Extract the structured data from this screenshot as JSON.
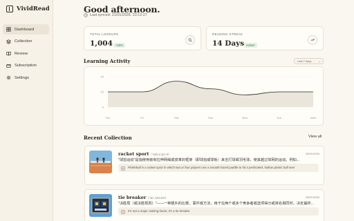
{
  "app": {
    "name": "VividRead"
  },
  "sidebar": {
    "items": [
      {
        "label": "Dashboard",
        "icon": "grid-icon",
        "active": true
      },
      {
        "label": "Collection",
        "icon": "layers-icon"
      },
      {
        "label": "Review",
        "icon": "book-icon"
      },
      {
        "label": "Subscription",
        "icon": "card-icon"
      },
      {
        "label": "Settings",
        "icon": "gear-icon"
      }
    ]
  },
  "header": {
    "greeting": "Good afternoon.",
    "last_synced": "Last synced: 21/01/2026, 23:12:27"
  },
  "stats": {
    "lookups": {
      "label": "TOTAL LOOKUPS",
      "value": "1,004",
      "change": "+18%",
      "icon": "search-icon"
    },
    "streak": {
      "label": "READING STREAK",
      "value": "14 Days",
      "status": "Active!",
      "icon": "trend-up-icon"
    }
  },
  "activity": {
    "title": "Learning Activity",
    "range": "Last 7 days"
  },
  "chart_data": {
    "type": "area",
    "categories": [
      "Thu",
      "Fri",
      "Sat",
      "Sun",
      "Mon",
      "Tue",
      "Wed"
    ],
    "values": [
      10,
      10,
      17,
      12,
      8,
      10,
      10
    ],
    "ylim": [
      0,
      20
    ],
    "yticks": [
      0,
      10,
      20
    ],
    "grid": true
  },
  "collection": {
    "title": "Recent Collection",
    "view_all": "View all",
    "entries": [
      {
        "word": "racket sport",
        "pos": "/ˈræk.ɪt spɔːrt/",
        "date": "30/01/2026",
        "definition": "\"球拍运动\"是指使用装有拉伸网绳或皮革的框架（即球拍或球板）来击打球或羽毛球，使其越过球网的运动。例如...",
        "example": "Pickleball is a racket sport in which two or four players use a smooth-faced paddle to hit a perforated, hollow plastic ball over",
        "thumb": "tennis-court-image"
      },
      {
        "word": "tie breaker",
        "pos": "/ˈtaɪ ˌbreɪ.kər/",
        "date": "30/01/2026",
        "definition": "\"决胜局（或决胜规则）\"——一种额外的比赛、事件或方法，用于在两个或多个竞争者或选项得分或排名相同时，决定最终...",
        "example": "It's not a major ranking factor, it's a tie breaker",
        "thumb": "scoreboard-image"
      }
    ]
  }
}
